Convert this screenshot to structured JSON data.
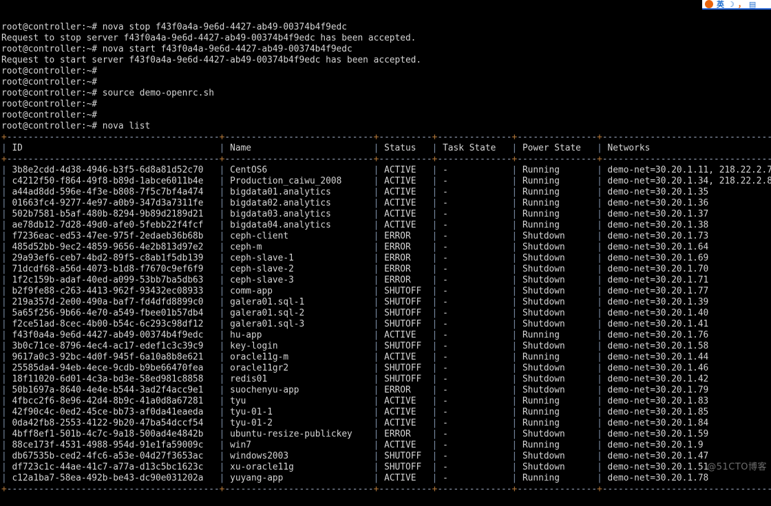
{
  "terminal": {
    "prompt": "root@controller:~# ",
    "scrollback": [
      {
        "type": "prompt",
        "command": "nova stop f43f0a4a-9e6d-4427-ab49-00374b4f9edc"
      },
      {
        "type": "output",
        "text": "Request to stop server f43f0a4a-9e6d-4427-ab49-00374b4f9edc has been accepted."
      },
      {
        "type": "prompt",
        "command": "nova start f43f0a4a-9e6d-4427-ab49-00374b4f9edc"
      },
      {
        "type": "output",
        "text": "Request to start server f43f0a4a-9e6d-4427-ab49-00374b4f9edc has been accepted."
      },
      {
        "type": "prompt",
        "command": ""
      },
      {
        "type": "prompt",
        "command": ""
      },
      {
        "type": "prompt",
        "command": "source demo-openrc.sh"
      },
      {
        "type": "prompt",
        "command": ""
      },
      {
        "type": "prompt",
        "command": ""
      },
      {
        "type": "prompt",
        "command": "nova list"
      }
    ]
  },
  "table": {
    "columns": [
      {
        "key": "id",
        "label": "ID",
        "width": 38
      },
      {
        "key": "name",
        "label": "Name",
        "width": 26
      },
      {
        "key": "status",
        "label": "Status",
        "width": 8
      },
      {
        "key": "task_state",
        "label": "Task State",
        "width": 12
      },
      {
        "key": "power_state",
        "label": "Power State",
        "width": 13
      },
      {
        "key": "networks",
        "label": "Networks",
        "width": 31
      }
    ],
    "rows": [
      {
        "id": "3b8e2cdd-4d38-4946-b3f5-6d8a81d52c70",
        "name": "CentOS6",
        "status": "ACTIVE",
        "task_state": "-",
        "power_state": "Running",
        "networks": "demo-net=30.20.1.11, 218.22.2.7"
      },
      {
        "id": "c4212f50-f864-49f8-b89d-1abce6011b4e",
        "name": "Production_caiwu_2008",
        "status": "ACTIVE",
        "task_state": "-",
        "power_state": "Running",
        "networks": "demo-net=30.20.1.34, 218.22.2.8"
      },
      {
        "id": "a44ad8dd-596e-4f3e-b808-7f5c7bf4a474",
        "name": "bigdata01.analytics",
        "status": "ACTIVE",
        "task_state": "-",
        "power_state": "Running",
        "networks": "demo-net=30.20.1.35"
      },
      {
        "id": "01663fc4-9277-4e97-a0b9-347d3a7311fe",
        "name": "bigdata02.analytics",
        "status": "ACTIVE",
        "task_state": "-",
        "power_state": "Running",
        "networks": "demo-net=30.20.1.36"
      },
      {
        "id": "502b7581-b5af-480b-8294-9b89d2189d21",
        "name": "bigdata03.analytics",
        "status": "ACTIVE",
        "task_state": "-",
        "power_state": "Running",
        "networks": "demo-net=30.20.1.37"
      },
      {
        "id": "ae78db12-7d28-49d0-afe0-5febb22f4fcf",
        "name": "bigdata04.analytics",
        "status": "ACTIVE",
        "task_state": "-",
        "power_state": "Running",
        "networks": "demo-net=30.20.1.38"
      },
      {
        "id": "f7236eac-ed53-47ee-975f-2edaeb36b68b",
        "name": "ceph-client",
        "status": "ERROR",
        "task_state": "-",
        "power_state": "Shutdown",
        "networks": "demo-net=30.20.1.73"
      },
      {
        "id": "485d52bb-9ec2-4859-9656-4e2b813d97e2",
        "name": "ceph-m",
        "status": "ERROR",
        "task_state": "-",
        "power_state": "Shutdown",
        "networks": "demo-net=30.20.1.64"
      },
      {
        "id": "29a93ef6-ceb7-4bd2-89f5-c8ab1f5db139",
        "name": "ceph-slave-1",
        "status": "ERROR",
        "task_state": "-",
        "power_state": "Shutdown",
        "networks": "demo-net=30.20.1.69"
      },
      {
        "id": "71dcdf68-a56d-4073-b1d8-f7670c9ef6f9",
        "name": "ceph-slave-2",
        "status": "ERROR",
        "task_state": "-",
        "power_state": "Shutdown",
        "networks": "demo-net=30.20.1.70"
      },
      {
        "id": "1f2c159b-adaf-40ed-a099-53bb7ba5db63",
        "name": "ceph-slave-3",
        "status": "ERROR",
        "task_state": "-",
        "power_state": "Shutdown",
        "networks": "demo-net=30.20.1.71"
      },
      {
        "id": "b2f9fe88-c263-4413-962f-93432ec08933",
        "name": "comm-app",
        "status": "SHUTOFF",
        "task_state": "-",
        "power_state": "Shutdown",
        "networks": "demo-net=30.20.1.77"
      },
      {
        "id": "219a357d-2e00-490a-baf7-fd4dfd8899c0",
        "name": "galera01.sql-1",
        "status": "SHUTOFF",
        "task_state": "-",
        "power_state": "Shutdown",
        "networks": "demo-net=30.20.1.39"
      },
      {
        "id": "5a65f256-9b66-4e70-a549-fbee01b57db4",
        "name": "galera01.sql-2",
        "status": "SHUTOFF",
        "task_state": "-",
        "power_state": "Shutdown",
        "networks": "demo-net=30.20.1.40"
      },
      {
        "id": "f2ce51ad-8cec-4b00-b54c-6c293c98df12",
        "name": "galera01.sql-3",
        "status": "SHUTOFF",
        "task_state": "-",
        "power_state": "Shutdown",
        "networks": "demo-net=30.20.1.41"
      },
      {
        "id": "f43f0a4a-9e6d-4427-ab49-00374b4f9edc",
        "name": "hu-app",
        "status": "ACTIVE",
        "task_state": "-",
        "power_state": "Running",
        "networks": "demo-net=30.20.1.76"
      },
      {
        "id": "3b0c71ce-8796-4ec4-ac17-edef1c3c39c9",
        "name": "key-login",
        "status": "SHUTOFF",
        "task_state": "-",
        "power_state": "Shutdown",
        "networks": "demo-net=30.20.1.58"
      },
      {
        "id": "9617a0c3-92bc-4d0f-945f-6a10a8b8e621",
        "name": "oracle11g-m",
        "status": "ACTIVE",
        "task_state": "-",
        "power_state": "Running",
        "networks": "demo-net=30.20.1.44"
      },
      {
        "id": "25585da4-94eb-4ece-9cdb-b9be66470fea",
        "name": "oracle11gr2",
        "status": "SHUTOFF",
        "task_state": "-",
        "power_state": "Shutdown",
        "networks": "demo-net=30.20.1.46"
      },
      {
        "id": "18f11020-6d01-4c3a-bd3e-58ed981c8858",
        "name": "redis01",
        "status": "SHUTOFF",
        "task_state": "-",
        "power_state": "Shutdown",
        "networks": "demo-net=30.20.1.42"
      },
      {
        "id": "50b1697a-8640-4e4e-b544-3ad2f4acc9e1",
        "name": "suochenyu-app",
        "status": "ERROR",
        "task_state": "-",
        "power_state": "Shutdown",
        "networks": "demo-net=30.20.1.79"
      },
      {
        "id": "4fbcc2f6-8e96-42d4-8b9c-41a0d8a67281",
        "name": "tyu",
        "status": "ACTIVE",
        "task_state": "-",
        "power_state": "Running",
        "networks": "demo-net=30.20.1.83"
      },
      {
        "id": "42f90c4c-0ed2-45ce-bb73-af0da41eaeda",
        "name": "tyu-01-1",
        "status": "ACTIVE",
        "task_state": "-",
        "power_state": "Running",
        "networks": "demo-net=30.20.1.85"
      },
      {
        "id": "0da42fb8-2553-4122-9b20-47ba54dccf54",
        "name": "tyu-01-2",
        "status": "ACTIVE",
        "task_state": "-",
        "power_state": "Running",
        "networks": "demo-net=30.20.1.84"
      },
      {
        "id": "4bff8ef1-501b-4c7c-9a18-500ad4e4842b",
        "name": "ubuntu-resize-publickey",
        "status": "ERROR",
        "task_state": "-",
        "power_state": "Shutdown",
        "networks": "demo-net=30.20.1.59"
      },
      {
        "id": "88ce173f-4531-4988-954d-91e1fa59009c",
        "name": "win7",
        "status": "ACTIVE",
        "task_state": "-",
        "power_state": "Running",
        "networks": "demo-net=30.20.1.9"
      },
      {
        "id": "db67535b-ced2-4fc6-a53e-04d27f3653ac",
        "name": "windows2003",
        "status": "SHUTOFF",
        "task_state": "-",
        "power_state": "Shutdown",
        "networks": "demo-net=30.20.1.47"
      },
      {
        "id": "df723c1c-44ae-41c7-a77a-d13c5bc1623c",
        "name": "xu-oracle11g",
        "status": "SHUTOFF",
        "task_state": "-",
        "power_state": "Shutdown",
        "networks": "demo-net=30.20.1.51"
      },
      {
        "id": "c12a1ba7-58ea-492b-be43-dc90e031202a",
        "name": "yuyang-app",
        "status": "ACTIVE",
        "task_state": "-",
        "power_state": "Running",
        "networks": "demo-net=30.20.1.78"
      }
    ]
  },
  "watermark": {
    "text": "@51CTO博客"
  },
  "ime": {
    "mode_label": "英",
    "punct_label": "，"
  },
  "colors": {
    "background": "#000000",
    "text": "#d4d4d4",
    "border_plus": "#b5793a",
    "border_pipe": "#7d8fa8",
    "border_dash": "#9aa7bd",
    "watermark": "#6d6d6d"
  }
}
